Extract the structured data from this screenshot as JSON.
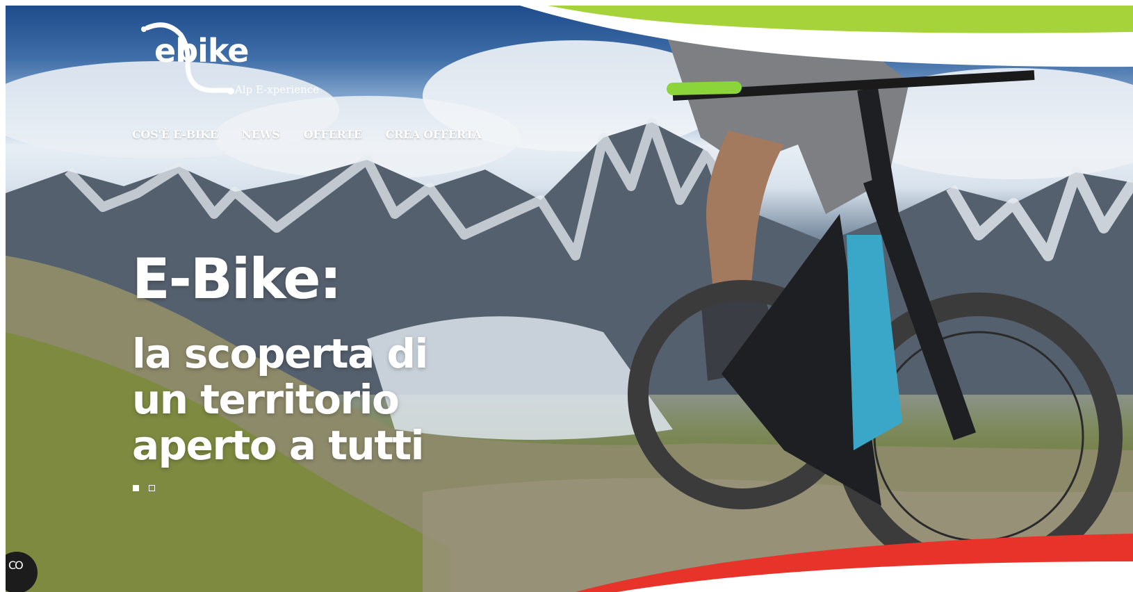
{
  "brand": {
    "logo_text": "ebike",
    "tagline": "Alp E-xperience",
    "accent_green": "#a6d23a",
    "accent_red": "#e8332a"
  },
  "nav": {
    "items": [
      {
        "label": "COS'È E-BIKE"
      },
      {
        "label": "NEWS"
      },
      {
        "label": "OFFERTE"
      },
      {
        "label": "CREA OFFERTA"
      }
    ]
  },
  "hero": {
    "title": "E-Bike:",
    "subtitle": "la scoperta di un territorio aperto a tutti",
    "background": "mountain landscape with cyclist on e-bike",
    "slides_total": 2,
    "active_slide": 1
  },
  "badge": {
    "label": "CO",
    "icon": "co-circle-icon"
  }
}
